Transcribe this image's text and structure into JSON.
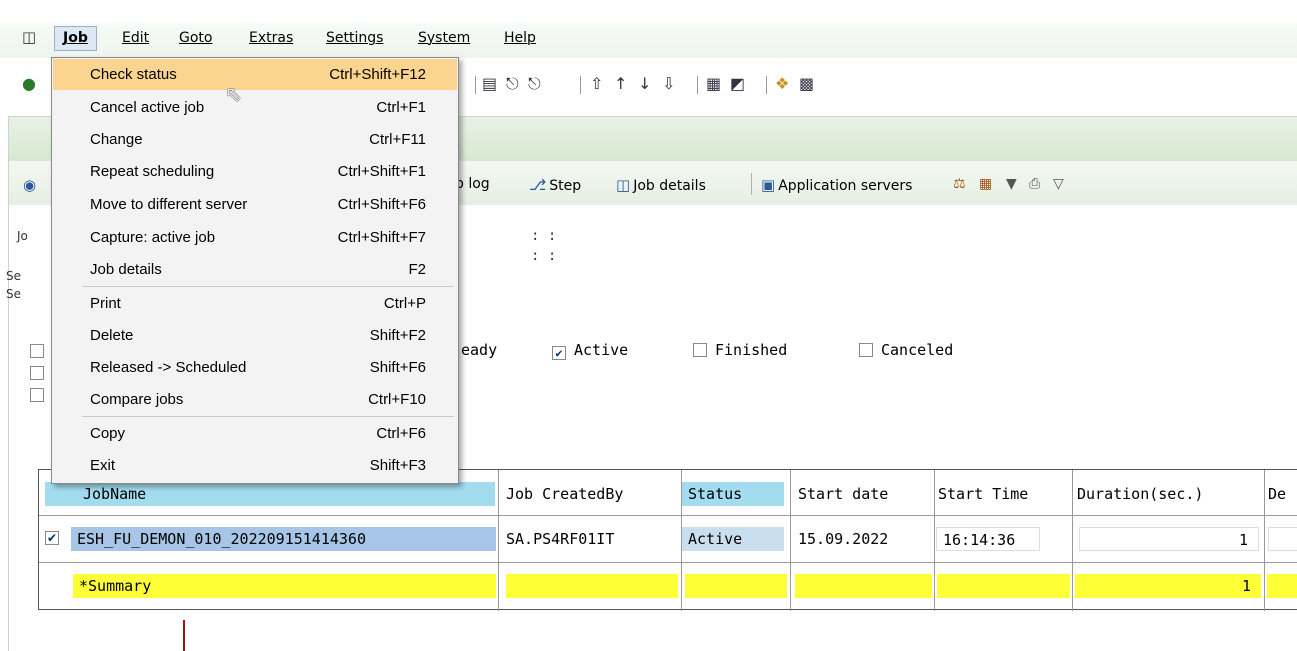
{
  "menubar": {
    "items": [
      "Job",
      "Edit",
      "Goto",
      "Extras",
      "Settings",
      "System",
      "Help"
    ]
  },
  "job_menu": {
    "items": [
      {
        "label": "Check status",
        "shortcut": "Ctrl+Shift+F12",
        "highlighted": true
      },
      {
        "label": "Cancel active job",
        "shortcut": "Ctrl+F1"
      },
      {
        "label": "Change",
        "shortcut": "Ctrl+F11"
      },
      {
        "label": "Repeat scheduling",
        "shortcut": "Ctrl+Shift+F1"
      },
      {
        "label": "Move to different server",
        "shortcut": "Ctrl+Shift+F6"
      },
      {
        "label": "Capture: active job",
        "shortcut": "Ctrl+Shift+F7"
      },
      {
        "label": "Job details",
        "shortcut": "F2"
      },
      {
        "label": "Print",
        "shortcut": "Ctrl+P"
      },
      {
        "label": "Delete",
        "shortcut": "Shift+F2"
      },
      {
        "label": "Released -> Scheduled",
        "shortcut": "Shift+F6"
      },
      {
        "label": "Compare jobs",
        "shortcut": "Ctrl+F10"
      },
      {
        "label": "Copy",
        "shortcut": "Ctrl+F6"
      },
      {
        "label": "Exit",
        "shortcut": "Shift+F3"
      }
    ]
  },
  "app_toolbar": {
    "job_log_label": "b log",
    "step_label": "Step",
    "job_details_label": "Job details",
    "app_servers_label": "Application servers"
  },
  "selection": {
    "time_separator": ":   :",
    "status_filters": {
      "ready_fragment": "eady",
      "active": "Active",
      "finished": "Finished",
      "canceled": "Canceled"
    },
    "active_checked": true
  },
  "table": {
    "columns": [
      "JobName",
      "Job CreatedBy",
      "Status",
      "Start date",
      "Start Time",
      "Duration(sec.)",
      "De"
    ],
    "rows": [
      {
        "checked": true,
        "job_name": "ESH_FU_DEMON_010_202209151414360",
        "created_by": "SA.PS4RF01IT",
        "status": "Active",
        "start_date": "15.09.2022",
        "start_time": "16:14:36",
        "duration": "1"
      }
    ],
    "summary": {
      "label": "*Summary",
      "duration": "1"
    }
  },
  "colors": {
    "menu_highlight": "#fbd48f",
    "header_blue": "#a3dcef",
    "jobname_blue": "#a7c5e6",
    "summary_yellow": "#ffff38"
  }
}
